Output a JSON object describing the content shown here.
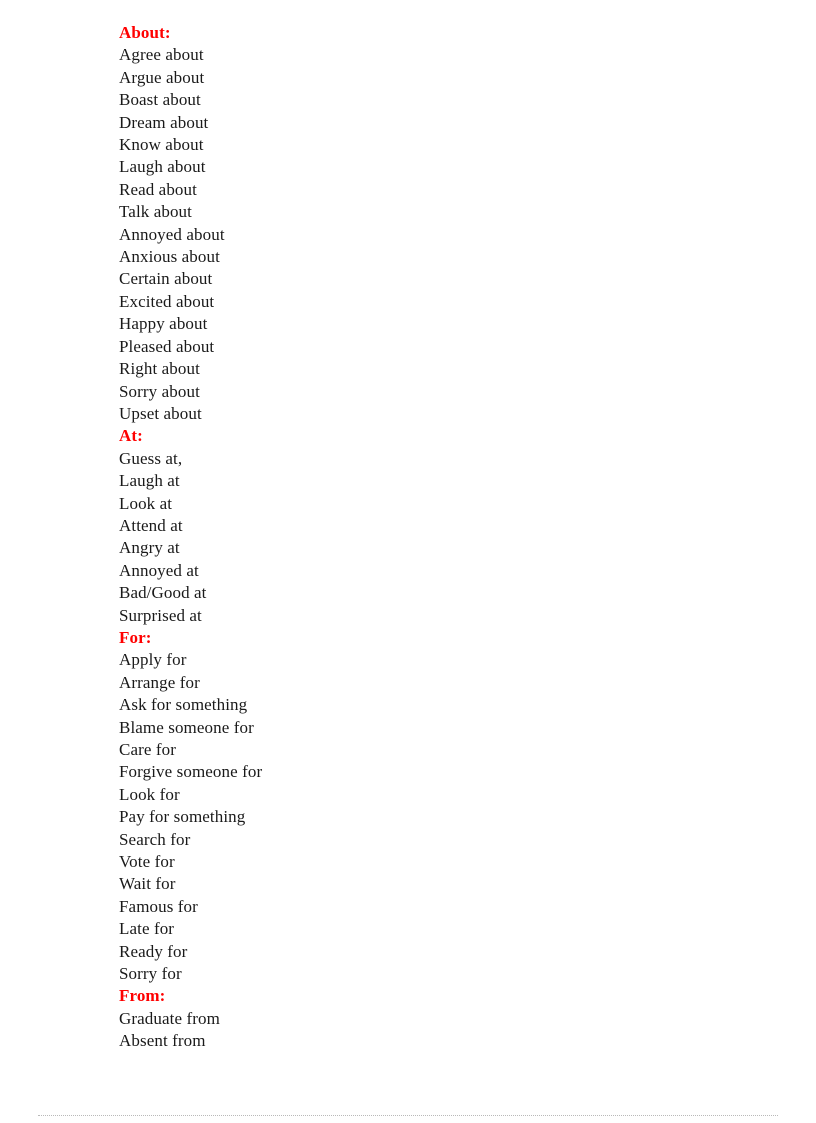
{
  "document": {
    "accent_color": "#ff0000",
    "text_color": "#1a1a1a",
    "background_color": "#ffffff",
    "footer_rule_color": "#b9b9b9",
    "sections": [
      {
        "heading": "About:",
        "entries": [
          "Agree about",
          "Argue about",
          "Boast about",
          "Dream about",
          "Know about",
          "Laugh about",
          "Read about",
          "Talk about",
          "Annoyed about",
          "Anxious about",
          "Certain about",
          "Excited about",
          "Happy about",
          "Pleased about",
          "Right about",
          "Sorry about",
          "Upset about"
        ]
      },
      {
        "heading": "At:",
        "entries": [
          "Guess at,",
          "Laugh at",
          "Look at",
          "Attend at",
          "Angry at",
          "Annoyed at",
          "Bad/Good at",
          "Surprised at"
        ]
      },
      {
        "heading": "For:",
        "entries": [
          "Apply for",
          "Arrange for",
          "Ask for something",
          "Blame someone for",
          "Care for",
          "Forgive someone for",
          "Look for",
          "Pay for something",
          "Search for",
          "Vote for",
          "Wait for",
          "Famous for",
          "Late for",
          "Ready for",
          "Sorry for"
        ]
      },
      {
        "heading": "From:",
        "entries": [
          "Graduate from",
          "Absent from"
        ]
      }
    ]
  }
}
